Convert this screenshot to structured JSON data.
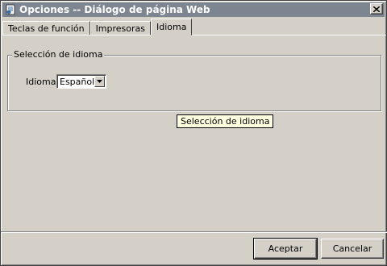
{
  "window": {
    "title": "Opciones -- Diálogo de página Web",
    "title_icon": "ie-page-icon",
    "titlebar_color": "#7c8590"
  },
  "tabs": [
    {
      "label": "Teclas de función",
      "active": false
    },
    {
      "label": "Impresoras",
      "active": false
    },
    {
      "label": "Idioma",
      "active": true
    }
  ],
  "group": {
    "legend": "Selección de idioma",
    "language_label": "Idioma",
    "language_value": "Español"
  },
  "tooltip": "Selección de idioma",
  "buttons": {
    "ok": "Aceptar",
    "cancel": "Cancelar"
  }
}
